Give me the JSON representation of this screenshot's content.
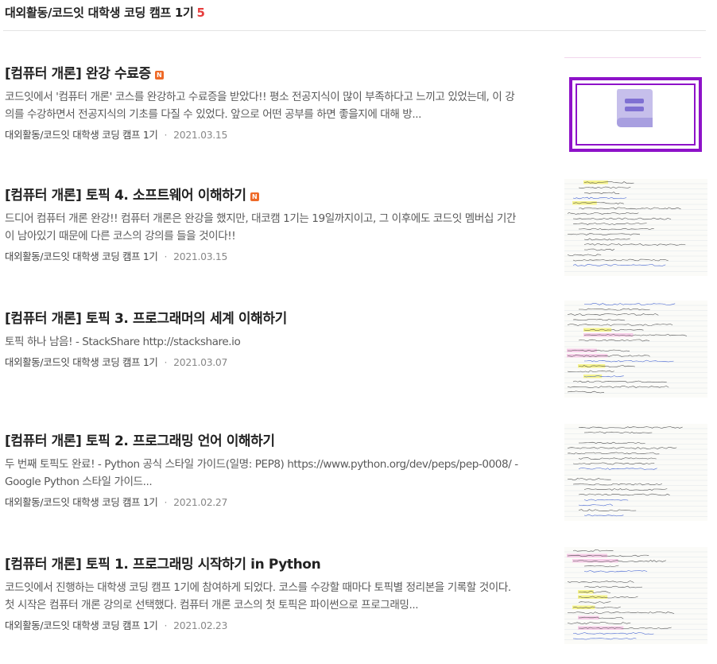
{
  "header": {
    "title": "대외활동/코드잇 대학생 코딩 캠프 1기",
    "count": "5"
  },
  "posts": [
    {
      "title": "[컴퓨터 개론] 완강 수료증",
      "badge": "N",
      "excerpt": "코드잇에서 '컴퓨터 개론' 코스를 완강하고 수료증을 받았다!! 평소 전공지식이 많이 부족하다고 느끼고 있었는데, 이 강의를 수강하면서 전공지식의 기초를 다질 수 있었다. 앞으로 어떤 공부를 하면 좋을지에 대해 방...",
      "category": "대외활동/코드잇 대학생 코딩 캠프 1기",
      "date": "2021.03.15",
      "thumb_icon": "book-icon"
    },
    {
      "title": "[컴퓨터 개론] 토픽 4. 소프트웨어 이해하기",
      "badge": "N",
      "excerpt": "드디어 컴퓨터 개론 완강!! 컴퓨터 개론은 완강을 했지만, 대코캠 1기는 19일까지이고, 그 이후에도 코드잇 멤버십 기간이 남아있기 때문에 다른 코스의 강의를 들을 것이다!!",
      "category": "대외활동/코드잇 대학생 코딩 캠프 1기",
      "date": "2021.03.15",
      "thumb_icon": "handwritten-notes"
    },
    {
      "title": "[컴퓨터 개론] 토픽 3. 프로그래머의 세계 이해하기",
      "badge": "",
      "excerpt": "토픽 하나 남음! - StackShare http://stackshare.io",
      "category": "대외활동/코드잇 대학생 코딩 캠프 1기",
      "date": "2021.03.07",
      "thumb_icon": "handwritten-notes"
    },
    {
      "title": "[컴퓨터 개론] 토픽 2. 프로그래밍 언어 이해하기",
      "badge": "",
      "excerpt": "두 번째 토픽도 완료! - Python 공식 스타일 가이드(일명: PEP8) https://www.python.org/dev/peps/pep-0008/ - Google Python 스타일 가이드...",
      "category": "대외활동/코드잇 대학생 코딩 캠프 1기",
      "date": "2021.02.27",
      "thumb_icon": "handwritten-notes"
    },
    {
      "title": "[컴퓨터 개론] 토픽 1. 프로그래밍 시작하기 in Python",
      "badge": "",
      "excerpt": "코드잇에서 진행하는 대학생 코딩 캠프 1기에 참여하게 되었다. 코스를 수강할 때마다 토픽별 정리본을 기록할 것이다. 첫 시작은 컴퓨터 개론 강의로 선택했다. 컴퓨터 개론 코스의 첫 토픽은 파이썬으로 프로그래밍...",
      "category": "대외활동/코드잇 대학생 코딩 캠프 1기",
      "date": "2021.02.23",
      "thumb_icon": "handwritten-notes"
    }
  ]
}
